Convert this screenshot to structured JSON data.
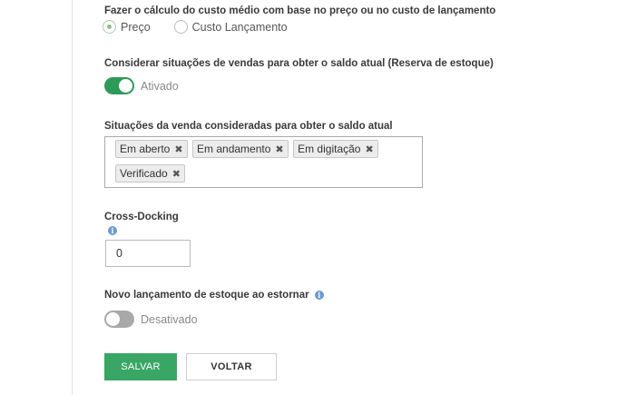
{
  "cost_calc": {
    "label": "Fazer o cálculo do custo médio com base no preço ou no custo de lançamento",
    "options": [
      {
        "label": "Preço",
        "checked": true
      },
      {
        "label": "Custo Lançamento",
        "checked": false
      }
    ]
  },
  "stock_reserve": {
    "label": "Considerar situações de vendas para obter o saldo atual (Reserva de estoque)",
    "toggle_on": true,
    "state_label": "Ativado"
  },
  "sale_situations": {
    "label": "Situações da venda consideradas para obter o saldo atual",
    "tags": [
      "Em aberto",
      "Em andamento",
      "Em digitação",
      "Verificado"
    ],
    "remove_glyph": "✖"
  },
  "cross_docking": {
    "label": "Cross-Docking",
    "info_icon": "info-icon",
    "value": "0"
  },
  "reverse_stock": {
    "label": "Novo lançamento de estoque ao estornar",
    "info_icon": "info-icon",
    "toggle_on": false,
    "state_label": "Desativado"
  },
  "actions": {
    "save_label": "SALVAR",
    "back_label": "VOLTAR"
  },
  "colors": {
    "primary": "#3aa665",
    "toggle_on": "#2d9b58",
    "toggle_off": "#a8a8a8",
    "info": "#6b9bd1"
  }
}
